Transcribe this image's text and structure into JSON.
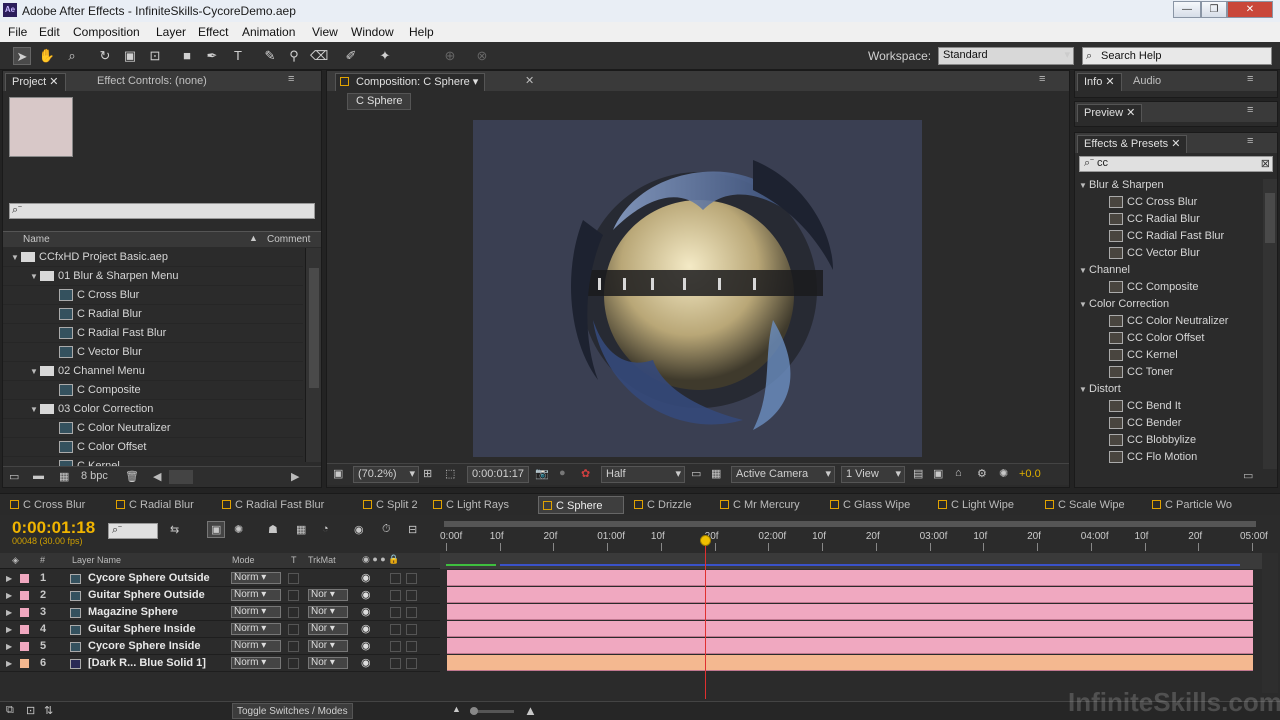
{
  "window": {
    "title": "Adobe After Effects - InfiniteSkills-CycoreDemo.aep",
    "app_icon": "Ae",
    "controls": [
      "—",
      "❐",
      "✕"
    ]
  },
  "menu": [
    "File",
    "Edit",
    "Composition",
    "Layer",
    "Effect",
    "Animation",
    "View",
    "Window",
    "Help"
  ],
  "toolbar": {
    "workspace_label": "Workspace:",
    "workspace_value": "Standard",
    "search_help": "Search Help"
  },
  "project": {
    "tab": "Project",
    "tab2": "Effect Controls: (none)",
    "col_name": "Name",
    "col_comment": "Comment",
    "bpc": "8 bpc",
    "items": [
      {
        "label": "CCfxHD Project Basic.aep",
        "indent": 0,
        "kind": "folder",
        "tw": "▼"
      },
      {
        "label": "01 Blur & Sharpen Menu",
        "indent": 1,
        "kind": "folder",
        "tw": "▼"
      },
      {
        "label": "C Cross Blur",
        "indent": 2,
        "kind": "comp",
        "tw": ""
      },
      {
        "label": "C Radial Blur",
        "indent": 2,
        "kind": "comp",
        "tw": ""
      },
      {
        "label": "C Radial Fast Blur",
        "indent": 2,
        "kind": "comp",
        "tw": ""
      },
      {
        "label": "C Vector Blur",
        "indent": 2,
        "kind": "comp",
        "tw": ""
      },
      {
        "label": "02 Channel Menu",
        "indent": 1,
        "kind": "folder",
        "tw": "▼"
      },
      {
        "label": "C Composite",
        "indent": 2,
        "kind": "comp",
        "tw": ""
      },
      {
        "label": "03 Color Correction",
        "indent": 1,
        "kind": "folder",
        "tw": "▼"
      },
      {
        "label": "C Color Neutralizer",
        "indent": 2,
        "kind": "comp",
        "tw": ""
      },
      {
        "label": "C Color Offset",
        "indent": 2,
        "kind": "comp",
        "tw": ""
      },
      {
        "label": "C Kernel",
        "indent": 2,
        "kind": "comp",
        "tw": ""
      }
    ]
  },
  "composition": {
    "tab": "Composition: C Sphere",
    "subtab": "C Sphere",
    "zoom": "(70.2%)",
    "timecode": "0:00:01:17",
    "resolution": "Half",
    "camera": "Active Camera",
    "views": "1 View",
    "exposure": "+0.0"
  },
  "info_panel": {
    "tab1": "Info",
    "tab2": "Audio",
    "preview_tab": "Preview"
  },
  "effects": {
    "tab": "Effects & Presets",
    "search": "cc",
    "groups": [
      {
        "name": "Blur & Sharpen",
        "items": [
          "CC Cross Blur",
          "CC Radial Blur",
          "CC Radial Fast Blur",
          "CC Vector Blur"
        ]
      },
      {
        "name": "Channel",
        "items": [
          "CC Composite"
        ]
      },
      {
        "name": "Color Correction",
        "items": [
          "CC Color Neutralizer",
          "CC Color Offset",
          "CC Kernel",
          "CC Toner"
        ]
      },
      {
        "name": "Distort",
        "items": [
          "CC Bend It",
          "CC Bender",
          "CC Blobbylize",
          "CC Flo Motion"
        ]
      }
    ]
  },
  "timeline": {
    "tabs": [
      "C Cross Blur",
      "C Radial Blur",
      "C Radial Fast Blur",
      "C Split 2",
      "C Light Rays",
      "C Sphere",
      "C Drizzle",
      "C Mr Mercury",
      "C Glass Wipe",
      "C Light Wipe",
      "C Scale Wipe",
      "C Particle Wo"
    ],
    "active_tab": "C Sphere",
    "timecode": "0:00:01:18",
    "frames": "00048 (30.00 fps)",
    "col_hash": "#",
    "col_layer": "Layer Name",
    "col_mode": "Mode",
    "col_t": "T",
    "col_trkmat": "TrkMat",
    "ruler": [
      "0:00f",
      "10f",
      "20f",
      "01:00f",
      "10f",
      "20f",
      "02:00f",
      "10f",
      "20f",
      "03:00f",
      "10f",
      "20f",
      "04:00f",
      "10f",
      "20f",
      "05:00f"
    ],
    "layers": [
      {
        "num": "1",
        "name": "Cycore Sphere Outside",
        "mode": "Norm",
        "trkmat": ""
      },
      {
        "num": "2",
        "name": "Guitar Sphere Outside",
        "mode": "Norm",
        "trkmat": "Nor"
      },
      {
        "num": "3",
        "name": "Magazine Sphere",
        "mode": "Norm",
        "trkmat": "Nor"
      },
      {
        "num": "4",
        "name": "Guitar Sphere Inside",
        "mode": "Norm",
        "trkmat": "Nor"
      },
      {
        "num": "5",
        "name": "Cycore Sphere Inside",
        "mode": "Norm",
        "trkmat": "Nor"
      },
      {
        "num": "6",
        "name": "[Dark R... Blue Solid 1]",
        "mode": "Norm",
        "trkmat": "Nor"
      }
    ],
    "toggle_label": "Toggle Switches / Modes",
    "playhead_fraction": 0.32
  },
  "watermark": "InfiniteSkills.com",
  "colors": {
    "accent": "#f0b400",
    "layer_bar": "#f0a8c0",
    "solid_bar": "#f4b890",
    "playhead": "#e03030"
  }
}
